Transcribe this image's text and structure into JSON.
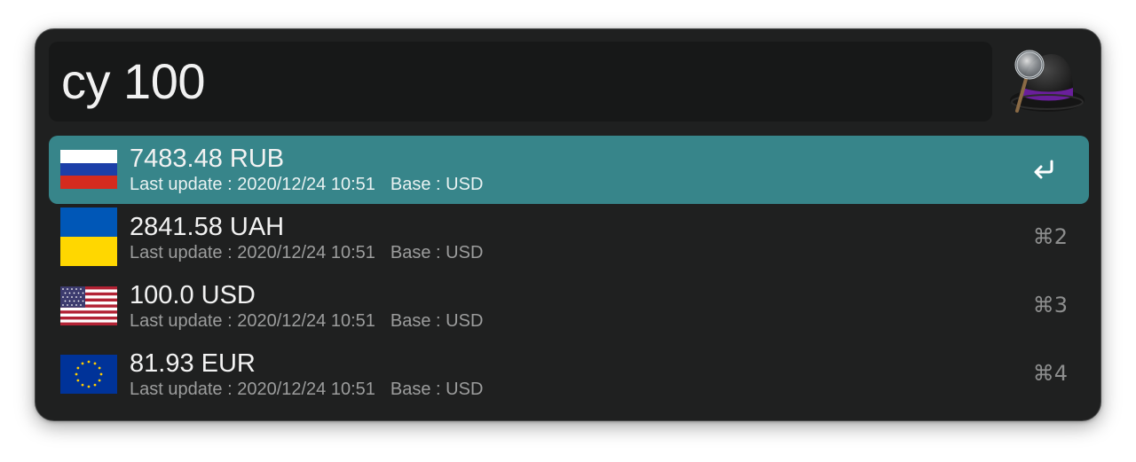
{
  "search": {
    "query": "cy 100"
  },
  "app": {
    "icon": "alfred-hat-magnifier-icon"
  },
  "results": [
    {
      "title": "7483.48 RUB",
      "last_update": "Last update : 2020/12/24 10:51",
      "base": "Base : USD",
      "flag": "russia-flag-icon",
      "shortcut": "return-key-icon",
      "selected": true
    },
    {
      "title": "2841.58 UAH",
      "last_update": "Last update : 2020/12/24 10:51",
      "base": "Base : USD",
      "flag": "ukraine-flag-icon",
      "shortcut": "⌘2",
      "selected": false
    },
    {
      "title": "100.0 USD",
      "last_update": "Last update : 2020/12/24 10:51",
      "base": "Base : USD",
      "flag": "usa-flag-icon",
      "shortcut": "⌘3",
      "selected": false
    },
    {
      "title": "81.93 EUR",
      "last_update": "Last update : 2020/12/24 10:51",
      "base": "Base : USD",
      "flag": "eu-flag-icon",
      "shortcut": "⌘4",
      "selected": false
    }
  ],
  "colors": {
    "window_bg": "#1f2020",
    "search_bg": "#171818",
    "selection": "#37858a",
    "russia_white": "#ffffff",
    "russia_blue": "#1c3fa8",
    "russia_red": "#d52b1e",
    "ukraine_blue": "#0057b7",
    "ukraine_yellow": "#ffd700",
    "usa_red": "#b22234",
    "usa_blue": "#3c3b6e",
    "eu_blue": "#003399",
    "eu_gold": "#ffcc00"
  }
}
